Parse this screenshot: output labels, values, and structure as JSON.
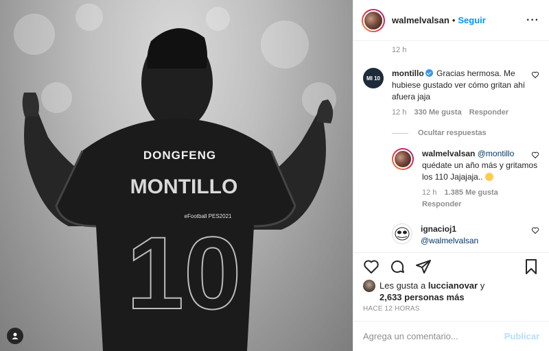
{
  "post": {
    "username": "walmelvalsan",
    "separator": "•",
    "follow_label": "Seguir",
    "more_label": "···"
  },
  "comments": {
    "top_time": "12 h",
    "reply1": {
      "username": "montillo",
      "text": "Gracias hermosa. Me hubiese gustado ver cómo gritan ahí afuera jaja",
      "time": "12 h",
      "likes": "330 Me gusta",
      "reply_label": "Responder",
      "avatar_text": "MI 10"
    },
    "hide_replies": "Ocultar respuestas",
    "reply2": {
      "username": "walmelvalsan",
      "mention": "@montillo",
      "text": "quédate un año más y gritamos los 110 Jajajaja..",
      "time": "12 h",
      "likes": "1.385 Me gusta",
      "reply_label": "Responder"
    },
    "reply3": {
      "username": "ignacioj1",
      "mention": "@walmelvalsan"
    }
  },
  "likes": {
    "prefix": "Les gusta a",
    "user": "luccianovar",
    "conj": "y",
    "count": "2,633 personas más"
  },
  "posted_ago": "HACE 12 HORAS",
  "comment_box": {
    "placeholder": "Agrega un comentario...",
    "publish_label": "Publicar"
  },
  "jersey": {
    "sponsor": "DONGFENG",
    "name": "MONTILLO",
    "number": "10",
    "badge": "eFootball PES2021"
  },
  "colors": {
    "link_blue": "#0095f6",
    "publish_disabled": "#b2dffc",
    "muted_text": "#8e8e8e"
  }
}
